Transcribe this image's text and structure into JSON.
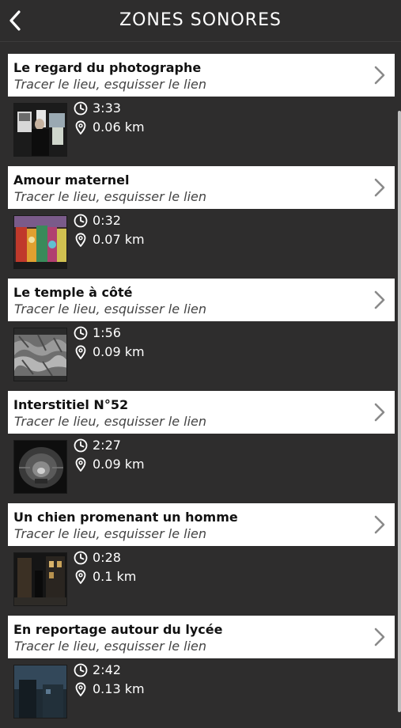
{
  "header": {
    "title": "ZONES SONORES",
    "back_icon": "chevron-left-icon"
  },
  "colors": {
    "background": "#2e2d2d",
    "card": "#ffffff",
    "text_light": "#ffffff",
    "text_dark": "#111111"
  },
  "items": [
    {
      "title": "Le regard du photographe",
      "subtitle": "Tracer le lieu, esquisser le lien",
      "duration": "3:33",
      "distance": "0.06 km"
    },
    {
      "title": "Amour maternel",
      "subtitle": "Tracer le lieu, esquisser le lien",
      "duration": "0:32",
      "distance": "0.07 km"
    },
    {
      "title": "Le temple à côté",
      "subtitle": "Tracer le lieu, esquisser le lien",
      "duration": "1:56",
      "distance": "0.09 km"
    },
    {
      "title": "Interstitiel N°52",
      "subtitle": "Tracer le lieu, esquisser le lien",
      "duration": "2:27",
      "distance": "0.09 km"
    },
    {
      "title": "Un chien promenant un homme",
      "subtitle": "Tracer le lieu, esquisser le lien",
      "duration": "0:28",
      "distance": "0.1 km"
    },
    {
      "title": "En reportage autour du lycée",
      "subtitle": "Tracer le lieu, esquisser le lien",
      "duration": "2:42",
      "distance": "0.13 km"
    }
  ]
}
